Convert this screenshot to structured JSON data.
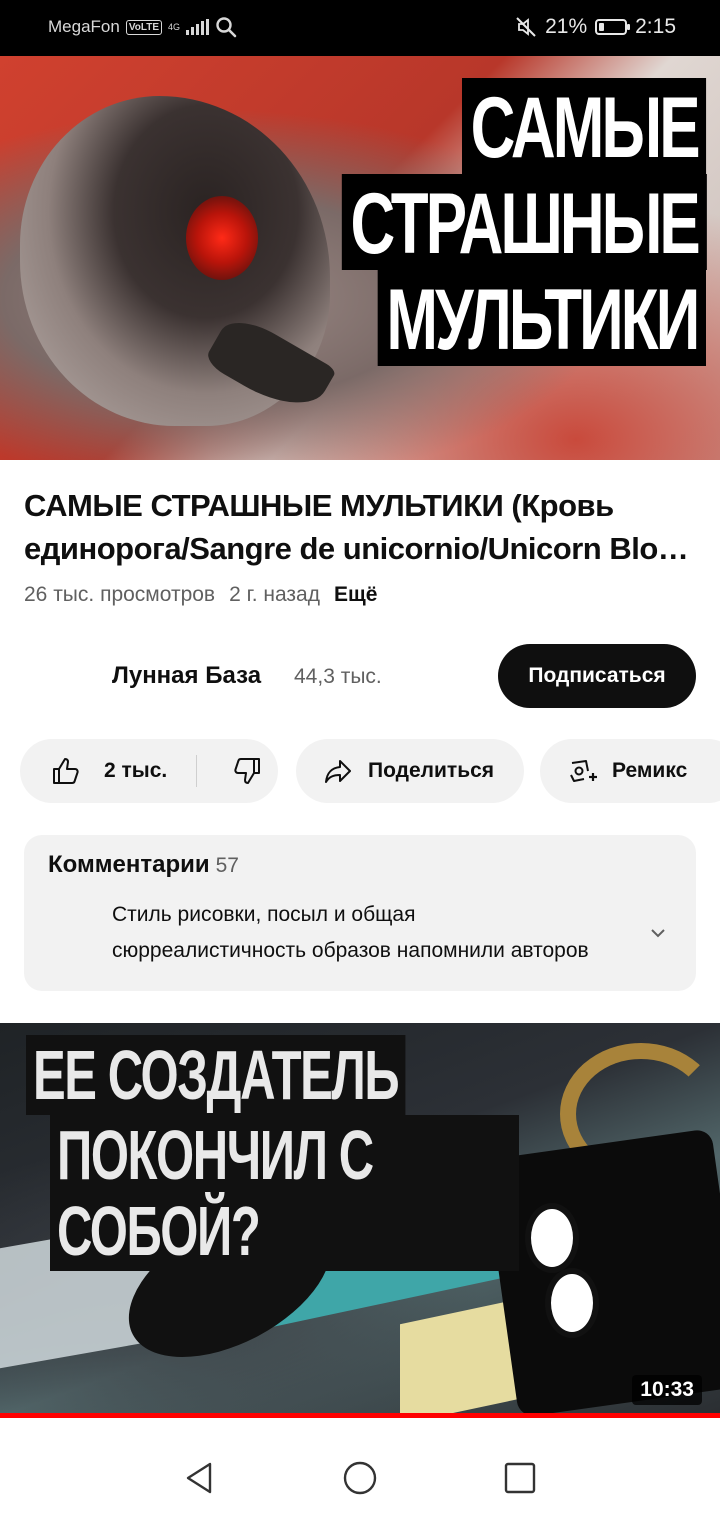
{
  "status_bar": {
    "carrier": "MegaFon",
    "volte": "VoLTE",
    "network": "4G",
    "battery_percent": "21%",
    "battery_level": 0.21,
    "time": "2:15",
    "icons": [
      "search-icon",
      "mute-icon",
      "battery-icon"
    ]
  },
  "hero": {
    "title_lines": [
      "САМЫЕ",
      "СТРАШНЫЕ",
      "МУЛЬТИКИ"
    ]
  },
  "video": {
    "title_line1": "САМЫЕ СТРАШНЫЕ МУЛЬТИКИ (Кровь",
    "title_line2": "единорога/Sangre de unicornio/Unicorn Blood)",
    "views": "26 тыс. просмотров",
    "age": "2 г. назад",
    "more": "Ещё"
  },
  "channel": {
    "name": "Лунная База",
    "subscribers": "44,3 тыс.",
    "subscribe_label": "Подписаться"
  },
  "actions": {
    "likes": "2 тыс.",
    "share_label": "Поделиться",
    "remix_label": "Ремикс"
  },
  "comments": {
    "header": "Комментарии",
    "count": "57",
    "preview_line1": "Стиль рисовки, посыл и общая",
    "preview_line2": "сюрреалистичность образов напомнили авторов"
  },
  "next_video": {
    "title_lines": [
      "ЕЕ СОЗДАТЕЛЬ",
      "ПОКОНЧИЛ С СОБОЙ?"
    ],
    "duration": "10:33",
    "progress": 1.0
  },
  "nav_bar": {
    "icons": [
      "back-icon",
      "home-icon",
      "recents-icon"
    ]
  },
  "colors": {
    "accent_red": "#ff0000",
    "subscribe_bg": "#0f0f0f",
    "pill_bg": "#f2f2f2",
    "secondary_text": "#606060"
  }
}
